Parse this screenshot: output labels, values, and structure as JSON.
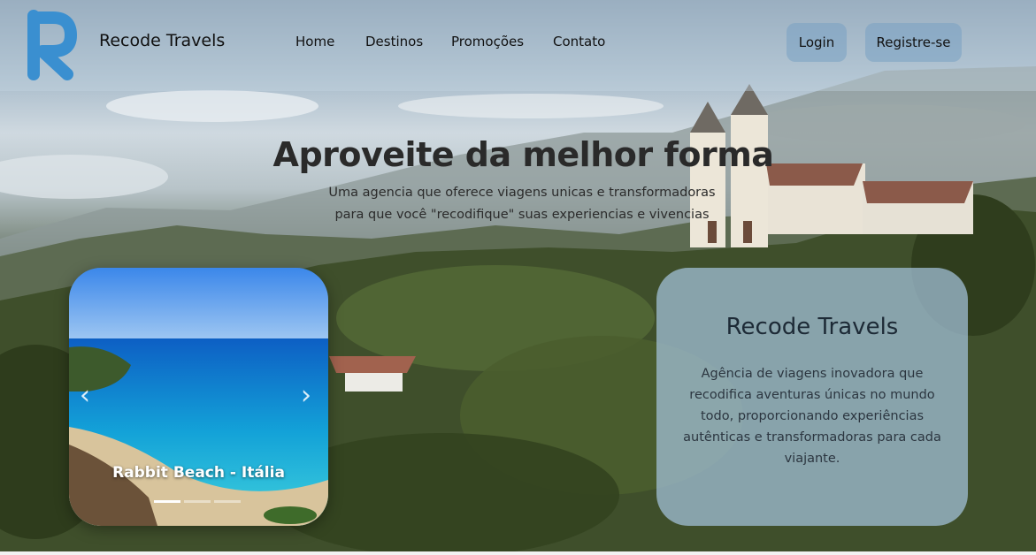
{
  "navbar": {
    "brand": "Recode Travels",
    "links": [
      "Home",
      "Destinos",
      "Promoções",
      "Contato"
    ],
    "login_label": "Login",
    "register_label": "Registre-se"
  },
  "hero": {
    "title": "Aproveite da melhor forma",
    "subtitle_line1": "Uma agencia que oferece viagens unicas e transformadoras",
    "subtitle_line2": "para que você \"recodifique\" suas experiencias e vivencias"
  },
  "carousel": {
    "caption": "Rabbit Beach - Itália",
    "prev_icon": "chevron-left-icon",
    "next_icon": "chevron-right-icon",
    "slide_count": 3,
    "active_slide": 1
  },
  "info_card": {
    "title": "Recode Travels",
    "text": "Agência de viagens inovadora que recodifica aventuras únicas no mundo todo, proporcionando experiências autênticas e transformadoras para cada viajante."
  },
  "colors": {
    "logo_blue": "#3a8fd0",
    "nav_button_bg": "#7aa0c3",
    "card_bg": "#a5c3dc"
  }
}
